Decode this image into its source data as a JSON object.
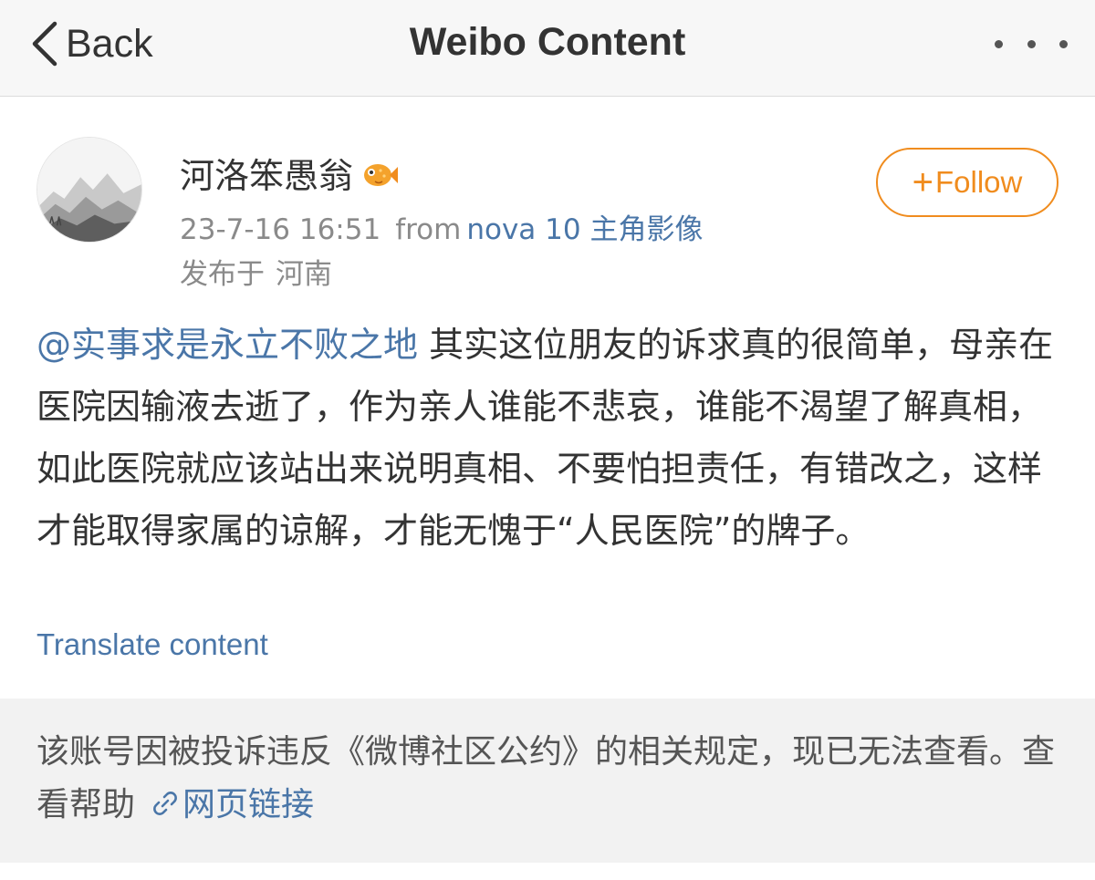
{
  "nav": {
    "back_label": "Back",
    "title": "Weibo Content"
  },
  "post": {
    "username": "河洛笨愚翁",
    "timestamp": "23-7-16 16:51",
    "from_label": "from",
    "source": "nova 10 主角影像",
    "location_prefix": "发布于",
    "location": "河南",
    "follow_label": "Follow",
    "mention": "@实事求是永立不败之地",
    "body_text": " 其实这位朋友的诉求真的很简单，母亲在医院因输液去逝了，作为亲人谁能不悲哀，谁能不渴望了解真相，如此医院就应该站出来说明真相、不要怕担责任，有错改之，这样才能取得家属的谅解，才能无愧于“人民医院”的牌子。",
    "translate_label": "Translate content"
  },
  "notice": {
    "text": "该账号因被投诉违反《微博社区公约》的相关规定，现已无法查看。",
    "help_label": "查看帮助",
    "link_label": "网页链接"
  },
  "colors": {
    "link_blue": "#4a76a8",
    "follow_orange": "#f08c1e",
    "meta_gray": "#8a8a8a",
    "notice_bg": "#f2f2f2"
  },
  "icons": [
    "back-chevron-icon",
    "more-dots-icon",
    "fish-badge-icon",
    "plus-icon",
    "link-icon"
  ]
}
